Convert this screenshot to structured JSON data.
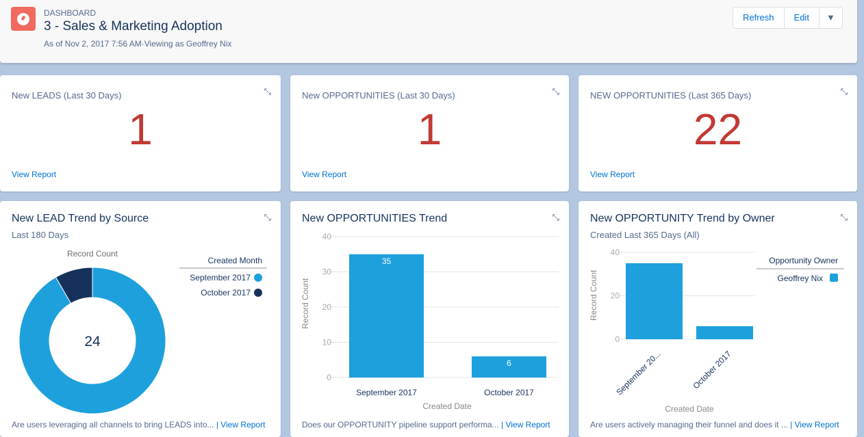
{
  "header": {
    "kicker": "DASHBOARD",
    "title": "3 - Sales & Marketing Adoption",
    "subtitle": "As of Nov 2, 2017 7:56 AM·Viewing as Geoffrey Nix",
    "refresh": "Refresh",
    "edit": "Edit",
    "menu_icon": "▼"
  },
  "metrics": [
    {
      "title": "New LEADS (Last 30 Days)",
      "value": "1",
      "link": "View Report"
    },
    {
      "title": "New OPPORTUNITIES (Last 30 Days)",
      "value": "1",
      "link": "View Report"
    },
    {
      "title": "NEW OPPORTUNITIES (Last 365 Days)",
      "value": "22",
      "link": "View Report"
    }
  ],
  "expand_icon": "⤡",
  "charts": [
    {
      "title": "New LEAD Trend by Source",
      "subtitle": "Last 180 Days",
      "footer": "Are users leveraging all channels to bring LEADS into...",
      "link": "| View Report"
    },
    {
      "title": "New OPPORTUNITIES Trend",
      "subtitle": "",
      "footer": "Does our OPPORTUNITY pipeline support performa...",
      "link": "| View Report"
    },
    {
      "title": "New OPPORTUNITY Trend by Owner",
      "subtitle": "Created Last 365 Days (All)",
      "footer": "Are users actively managing their funnel and does it ...",
      "link": "| View Report"
    }
  ],
  "chart_data": [
    {
      "type": "pie",
      "donut": true,
      "title": "New LEAD Trend by Source",
      "value_label": "Record Count",
      "center_total": "24",
      "legend_title": "Created Month",
      "legend_position": "right",
      "slices": [
        {
          "label": "September 2017",
          "value": 22,
          "color": "#1ea0dd"
        },
        {
          "label": "October 2017",
          "value": 2,
          "color": "#16325c"
        }
      ]
    },
    {
      "type": "bar",
      "title": "New OPPORTUNITIES Trend",
      "categories": [
        "September 2017",
        "October 2017"
      ],
      "values": [
        35,
        6
      ],
      "data_labels": [
        "35",
        "6"
      ],
      "xlabel": "Created Date",
      "ylabel": "Record Count",
      "ylim": [
        0,
        40
      ],
      "yticks": [
        "0",
        "10",
        "20",
        "30",
        "40"
      ],
      "color": "#1ea0dd"
    },
    {
      "type": "bar",
      "title": "New OPPORTUNITY Trend by Owner",
      "categories": [
        "September 20...",
        "October 2017"
      ],
      "values": [
        35,
        6
      ],
      "xlabel": "Created Date",
      "ylabel": "Record Count",
      "ylim": [
        0,
        40
      ],
      "yticks": [
        "0",
        "20",
        "40"
      ],
      "legend_title": "Opportunity Owner",
      "legend_position": "right",
      "series": [
        {
          "name": "Geoffrey Nix",
          "values": [
            35,
            6
          ],
          "color": "#1ea0dd"
        }
      ]
    }
  ]
}
